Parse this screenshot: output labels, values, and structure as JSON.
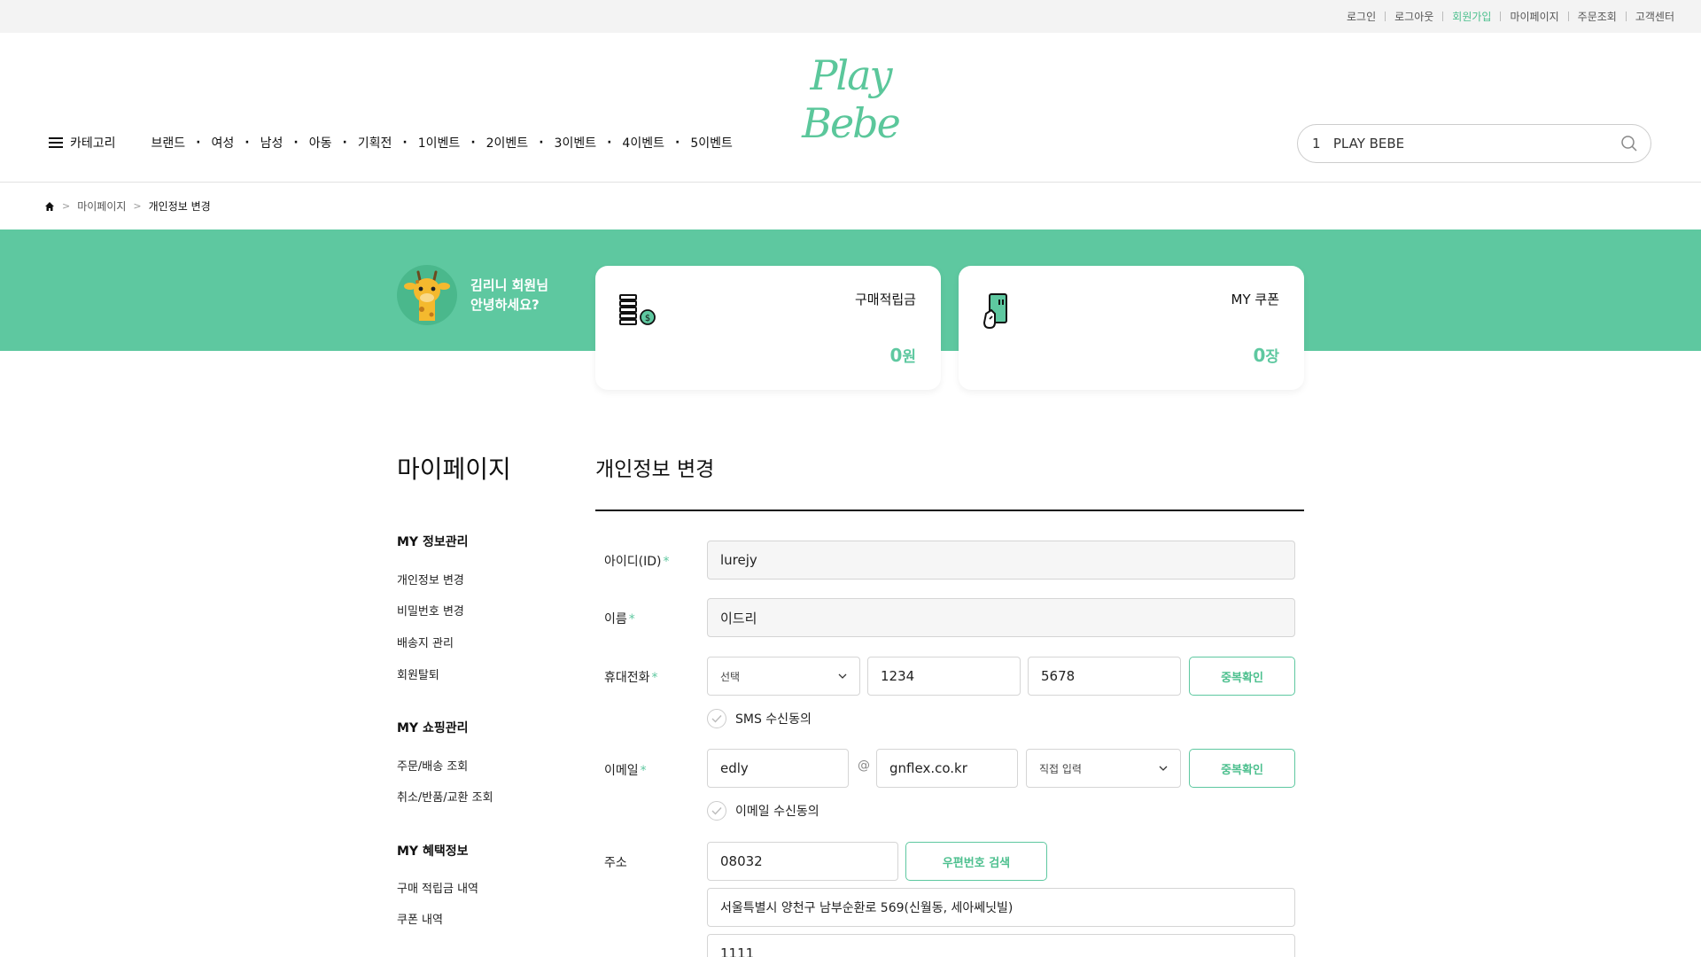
{
  "top_links": [
    {
      "label": "로그인",
      "active": false
    },
    {
      "label": "로그아웃",
      "active": false
    },
    {
      "label": "회원가입",
      "active": true
    },
    {
      "label": "마이페이지",
      "active": false
    },
    {
      "label": "주문조회",
      "active": false
    },
    {
      "label": "고객센터",
      "active": false
    }
  ],
  "logo": "Play Bebe",
  "nav": {
    "category_label": "카테고리",
    "items": [
      "브랜드",
      "여성",
      "남성",
      "아동",
      "기획전",
      "1이벤트",
      "2이벤트",
      "3이벤트",
      "4이벤트",
      "5이벤트"
    ]
  },
  "search": {
    "value": "1   PLAY BEBE",
    "icon": "search-icon"
  },
  "breadcrumb": {
    "items": [
      "마이페이지",
      "개인정보 변경"
    ]
  },
  "greeting": {
    "line1": "김리니 회원님",
    "line2": "안녕하세요?"
  },
  "cards": [
    {
      "title": "구매적립금",
      "value": "0",
      "unit": "원",
      "icon": "coins-icon"
    },
    {
      "title": "MY 쿠폰",
      "value": "0",
      "unit": "장",
      "icon": "coupon-icon"
    }
  ],
  "sidebar": {
    "title": "마이페이지",
    "groups": [
      {
        "title": "MY 정보관리",
        "links": [
          "개인정보 변경",
          "비밀번호 변경",
          "배송지 관리",
          "회원탈퇴"
        ]
      },
      {
        "title": "MY 쇼핑관리",
        "links": [
          "주문/배송 조회",
          "취소/반품/교환 조회"
        ]
      },
      {
        "title": "MY 혜택정보",
        "links": [
          "구매 적립금 내역",
          "쿠폰 내역"
        ]
      }
    ]
  },
  "form": {
    "title": "개인정보 변경",
    "required_mark": "*",
    "id_label": "아이디(ID)",
    "id_value": "lurejy",
    "name_label": "이름",
    "name_value": "이드리",
    "phone_label": "휴대전화",
    "phone_prefix": "선택",
    "phone_mid": "1234",
    "phone_last": "5678",
    "dup_check": "중복확인",
    "sms_agree": "SMS 수신동의",
    "email_label": "이메일",
    "email_local": "edly",
    "email_at": "@",
    "email_domain": "gnflex.co.kr",
    "email_select": "직접 입력",
    "email_agree": "이메일 수신동의",
    "address_label": "주소",
    "zipcode": "08032",
    "zip_search": "우편번호 검색",
    "address1": "서울특별시 양천구 남부순환로 569(신월동, 세아쎄닛빌)",
    "address2": "1111"
  },
  "colors": {
    "accent": "#5ec8a0",
    "topbar": "#f3f3f3"
  }
}
